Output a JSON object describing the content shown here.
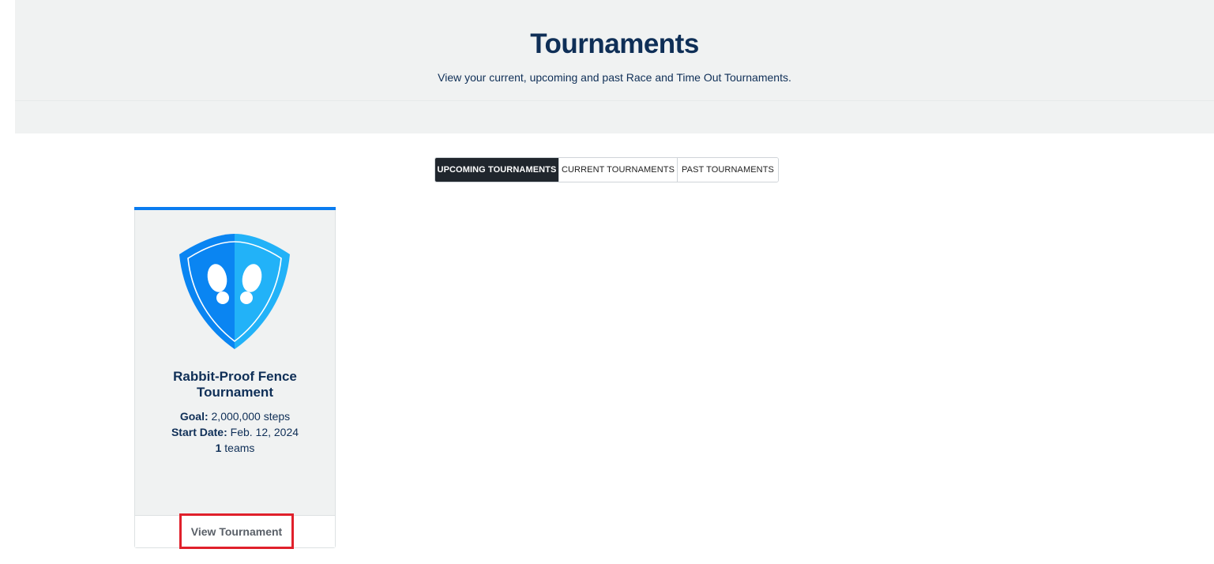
{
  "header": {
    "title": "Tournaments",
    "subtitle": "View your current, upcoming and past Race and Time Out Tournaments."
  },
  "tabs": [
    {
      "label": "UPCOMING TOURNAMENTS",
      "active": true
    },
    {
      "label": "CURRENT TOURNAMENTS",
      "active": false
    },
    {
      "label": "PAST TOURNAMENTS",
      "active": false
    }
  ],
  "tournament_card": {
    "icon": "footprints-shield-icon",
    "title": "Rabbit-Proof Fence Tournament",
    "goal_label": "Goal:",
    "goal_value": "2,000,000 steps",
    "start_label": "Start Date:",
    "start_value": "Feb. 12, 2024",
    "teams_count": "1",
    "teams_label": "teams",
    "button_label": "View Tournament"
  },
  "colors": {
    "accent": "#0a7cf0",
    "navy": "#0f2f57",
    "active_tab": "#20262d",
    "highlight_box": "#e0202b"
  }
}
